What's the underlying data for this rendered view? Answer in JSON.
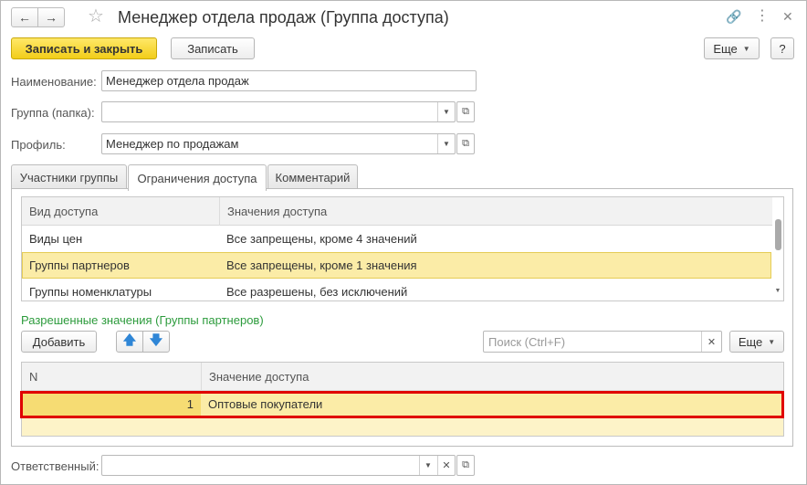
{
  "window": {
    "title": "Менеджер отдела продаж (Группа доступа)",
    "nav_back_icon": "arrow-left-icon",
    "nav_forward_icon": "arrow-right-icon"
  },
  "toolbar": {
    "save_close_label": "Записать и закрыть",
    "save_label": "Записать",
    "more_label": "Еще",
    "help_label": "?"
  },
  "form": {
    "name_label": "Наименование:",
    "name_value": "Менеджер отдела продаж",
    "group_label": "Группа (папка):",
    "group_value": "",
    "profile_label": "Профиль:",
    "profile_value": "Менеджер по продажам",
    "responsible_label": "Ответственный:",
    "responsible_value": ""
  },
  "tabs": [
    {
      "label": "Участники группы",
      "active": false
    },
    {
      "label": "Ограничения доступа",
      "active": true
    },
    {
      "label": "Комментарий",
      "active": false
    }
  ],
  "access_table": {
    "columns": [
      "Вид доступа",
      "Значения доступа"
    ],
    "rows": [
      {
        "kind": "Виды цен",
        "value": "Все запрещены, кроме 4 значений",
        "selected": false
      },
      {
        "kind": "Группы партнеров",
        "value": "Все запрещены, кроме 1 значения",
        "selected": true
      },
      {
        "kind": "Группы номенклатуры",
        "value": "Все разрешены, без исключений",
        "selected": false
      }
    ]
  },
  "allowed": {
    "title": "Разрешенные значения (Группы партнеров)",
    "add_label": "Добавить",
    "search_placeholder": "Поиск (Ctrl+F)",
    "more_label": "Еще",
    "columns": [
      "N",
      "Значение доступа"
    ],
    "rows": [
      {
        "n": "1",
        "value": "Оптовые покупатели"
      }
    ]
  },
  "colors": {
    "primary_button": "#f2cd19",
    "selected_row": "#fbeca7",
    "subtitle_green": "#2c9b3c",
    "highlight_red": "#e00000"
  }
}
